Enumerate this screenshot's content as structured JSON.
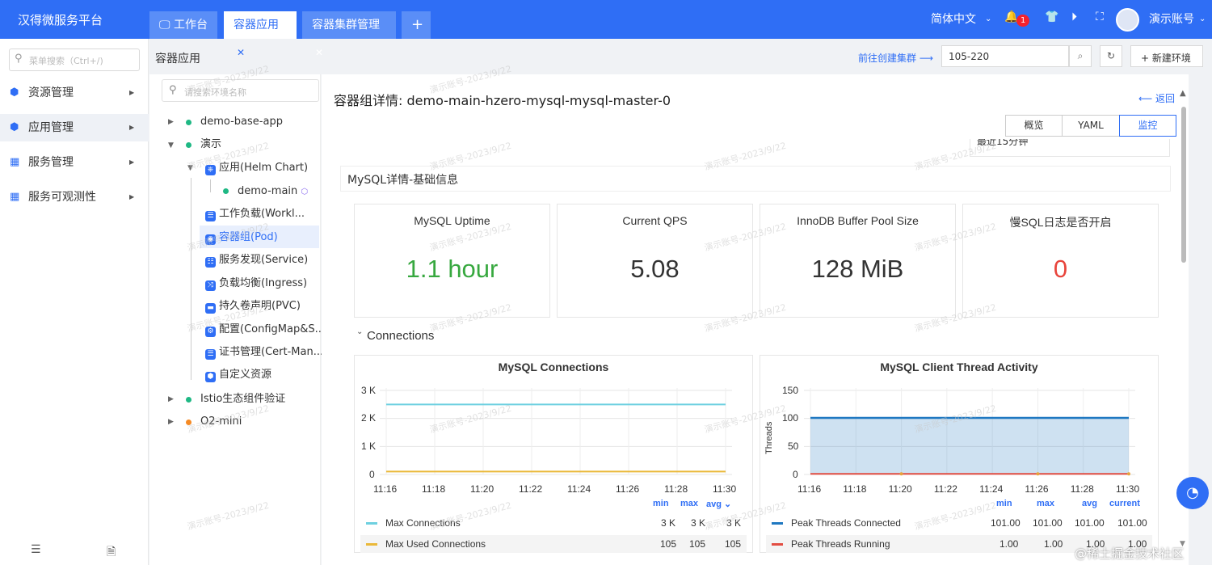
{
  "app": {
    "title": "汉得微服务平台"
  },
  "tabs": [
    {
      "label": "工作台",
      "closable": false
    },
    {
      "label": "容器应用",
      "closable": true,
      "active": true
    },
    {
      "label": "容器集群管理",
      "closable": true
    },
    {
      "label": "+"
    }
  ],
  "topright": {
    "language": "简体中文",
    "notifications": "1",
    "account": "演示账号"
  },
  "sidebar": {
    "search_placeholder": "菜单搜索（Ctrl+/)",
    "items": [
      {
        "label": "资源管理",
        "icon": "cube-icon"
      },
      {
        "label": "应用管理",
        "icon": "cube-icon"
      },
      {
        "label": "服务管理",
        "icon": "grid-icon"
      },
      {
        "label": "服务可观测性",
        "icon": "grid-icon"
      }
    ]
  },
  "page": {
    "title": "容器应用",
    "goto_cluster": "前往创建集群",
    "cluster_value": "105-220",
    "new_env": "新建环境"
  },
  "tree": {
    "search_placeholder": "请搜索环境名称",
    "nodes": [
      {
        "label": "demo-base-app"
      },
      {
        "label": "演示"
      },
      {
        "label": "应用(Helm Chart)"
      },
      {
        "label": "demo-main"
      },
      {
        "label": "工作负载(Workl..."
      },
      {
        "label": "容器组(Pod)"
      },
      {
        "label": "服务发现(Service)"
      },
      {
        "label": "负载均衡(Ingress)"
      },
      {
        "label": "持久卷声明(PVC)"
      },
      {
        "label": "配置(ConfigMap&S..."
      },
      {
        "label": "证书管理(Cert-Man..."
      },
      {
        "label": "自定义资源"
      },
      {
        "label": "Istio生态组件验证"
      },
      {
        "label": "O2-mini"
      }
    ]
  },
  "detail": {
    "title": "容器组详情: demo-main-hzero-mysql-mysql-master-0",
    "back": "返回",
    "view_buttons": [
      "概览",
      "YAML",
      "监控"
    ],
    "active_view": "监控",
    "time_range": "最近15分钟"
  },
  "basic": {
    "title": "MySQL详情-基础信息",
    "stats": [
      {
        "label": "MySQL Uptime",
        "value": "1.1 hour",
        "color": "#37a83f"
      },
      {
        "label": "Current QPS",
        "value": "5.08",
        "color": "#333333"
      },
      {
        "label": "InnoDB Buffer Pool Size",
        "value": "128 MiB",
        "color": "#333333"
      },
      {
        "label": "慢SQL日志是否开启",
        "value": "0",
        "color": "#e8453c"
      }
    ]
  },
  "connections_section": "Connections",
  "watermark": "演示账号-2023/9/22",
  "footer_badge": "@稀土掘金技术社区",
  "chart_data": [
    {
      "type": "line",
      "title": "MySQL Connections",
      "x": [
        "11:16",
        "11:18",
        "11:20",
        "11:22",
        "11:24",
        "11:26",
        "11:28",
        "11:30"
      ],
      "ylim": [
        0,
        3000
      ],
      "yticks": [
        "0",
        "1 K",
        "2 K",
        "3 K"
      ],
      "legend_headers": [
        "min",
        "max",
        "avg"
      ],
      "series": [
        {
          "name": "Max Connections",
          "color": "#6ed0e0",
          "values": [
            2500,
            2500,
            2500,
            2500,
            2500,
            2500,
            2500,
            2500
          ],
          "min": "3 K",
          "max": "3 K",
          "avg": "3 K"
        },
        {
          "name": "Max Used Connections",
          "color": "#eab839",
          "values": [
            105,
            105,
            105,
            105,
            105,
            105,
            105,
            105
          ],
          "min": "105",
          "max": "105",
          "avg": "105"
        }
      ]
    },
    {
      "type": "area",
      "title": "MySQL Client Thread Activity",
      "ylabel": "Threads",
      "x": [
        "11:16",
        "11:18",
        "11:20",
        "11:22",
        "11:24",
        "11:26",
        "11:28",
        "11:30"
      ],
      "ylim": [
        0,
        150
      ],
      "yticks": [
        "0",
        "50",
        "100",
        "150"
      ],
      "legend_headers": [
        "min",
        "max",
        "avg",
        "current"
      ],
      "series": [
        {
          "name": "Peak Threads Connected",
          "color": "#1f78c1",
          "values": [
            101,
            101,
            101,
            101,
            101,
            101,
            101,
            101
          ],
          "min": "101.00",
          "max": "101.00",
          "avg": "101.00",
          "current": "101.00"
        },
        {
          "name": "Peak Threads Running",
          "color": "#e24d42",
          "values": [
            1,
            1,
            1,
            1,
            1,
            1,
            1,
            1
          ],
          "min": "1.00",
          "max": "1.00",
          "avg": "1.00",
          "current": "1.00"
        }
      ]
    }
  ]
}
